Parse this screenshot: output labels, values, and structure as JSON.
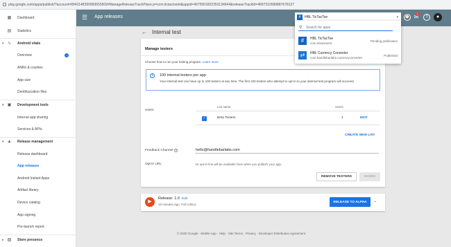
{
  "browser": {
    "url": "play.google.com/apps/publish/?account=8943148399983655509#ManageReleaseTrackPlace:p=com.tictactoeint&appid=4975501822353134644&releaseTrackId=4697310589887678127"
  },
  "sidebar": {
    "items": [
      {
        "label": "Dashboard",
        "icon": "dashboard-icon"
      },
      {
        "label": "Statistics",
        "icon": "statistics-icon"
      },
      {
        "label": "Android vitals",
        "icon": "vitals-icon"
      },
      {
        "label": "Overview"
      },
      {
        "label": "ANRs & crashes"
      },
      {
        "label": "App size"
      },
      {
        "label": "Deobfuscation files"
      },
      {
        "label": "Development tools",
        "icon": "tools-icon"
      },
      {
        "label": "Internal app sharing"
      },
      {
        "label": "Services & APIs"
      },
      {
        "label": "Release management",
        "icon": "release-icon"
      },
      {
        "label": "Release dashboard"
      },
      {
        "label": "App releases"
      },
      {
        "label": "Android Instant Apps"
      },
      {
        "label": "Artifact library"
      },
      {
        "label": "Device catalog"
      },
      {
        "label": "App signing"
      },
      {
        "label": "Pre-launch report"
      },
      {
        "label": "Store presence",
        "icon": "store-icon"
      }
    ],
    "overview_badge": "!"
  },
  "header": {
    "title": "App releases",
    "app_select": "HBL TicTacToe",
    "notifications_count": "1",
    "accent": "#607d8b"
  },
  "app_popup": {
    "search_placeholder": "Search for apps",
    "apps": [
      {
        "name": "HBL TicTacToe",
        "package": "com.tictactoeint",
        "status": "Pending publication",
        "icon_color": "#1565c0"
      },
      {
        "name": "HBL Currency Converter",
        "package": "com.handlebarlabs.currencyconverter",
        "status": "Published",
        "icon_color": "#1976d2"
      }
    ]
  },
  "page": {
    "title": "Internal test",
    "card_title": "Manage testers",
    "help_text": "Choose how to run your testing program.",
    "learn_more": "Learn more",
    "info_title": "100 internal testers per app",
    "info_body": "Your internal test can have up to 100 testers at any time. The first 100 testers who attempt to opt-in to your internal test program will succeed.",
    "users_label": "Users",
    "table": {
      "col_list_name": "List name",
      "col_users": "Users",
      "rows": [
        {
          "name": "Beta Testers",
          "users": "1",
          "action": "EDIT"
        }
      ]
    },
    "create_list": "CREATE NEW LIST",
    "feedback_label": "Feedback Channel",
    "feedback_value": "hello@handlebarlabs.com",
    "optin_label": "Opt-in URL",
    "optin_text": "An opt-in link will be available here when you publish your app.",
    "remove_testers": "REMOVE TESTERS",
    "saved": "SAVED"
  },
  "release": {
    "title": "Release: 1.0",
    "edit": "Edit",
    "subtitle": "15 minutes ago. Full rollout.",
    "promote": "RELEASE TO ALPHA"
  },
  "footer": "© 2020 Google · Mobile App · Help · Site Terms · Privacy · Developer Distribution Agreement"
}
